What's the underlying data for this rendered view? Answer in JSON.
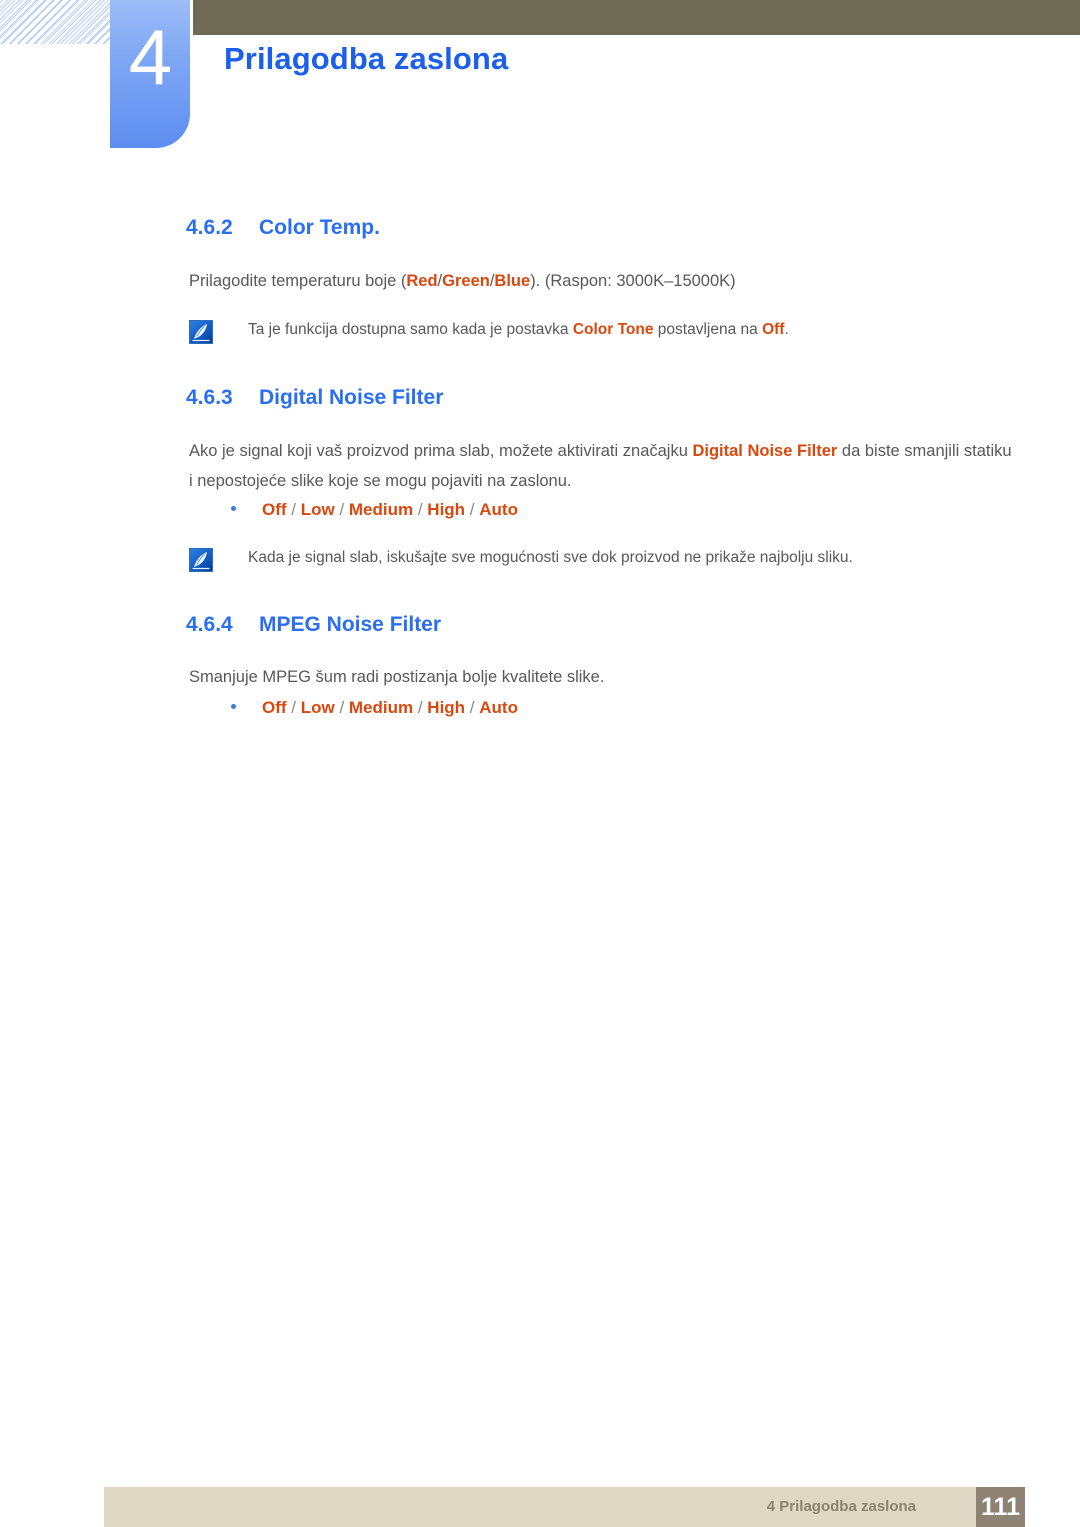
{
  "header": {
    "chapter_number": "4",
    "chapter_title": "Prilagodba zaslona",
    "accent_blue": "#1c5fe8",
    "tab_blue": "#7ea7f4",
    "olive": "#6e6a53"
  },
  "sections": [
    {
      "num": "4.6.2",
      "title": "Color Temp.",
      "body_pre": "Prilagodite temperaturu boje (",
      "body_hl1": "Red",
      "body_sep1": "/",
      "body_hl2": "Green",
      "body_sep2": "/",
      "body_hl3": "Blue",
      "body_post": "). (Raspon: 3000K–15000K)"
    },
    {
      "num": "4.6.3",
      "title": "Digital Noise Filter",
      "body_line1_pre": "Ako je signal koji vaš proizvod prima slab, možete aktivirati značajku ",
      "body_line1_hl": "Digital Noise Filter",
      "body_line1_post": " da biste smanjili",
      "body_line2": "statiku i nepostojeće slike koje se mogu pojaviti na zaslonu."
    },
    {
      "num": "4.6.4",
      "title": "MPEG Noise Filter",
      "body_line1": "Smanjuje MPEG šum radi postizanja bolje kvalitete slike."
    }
  ],
  "notes": [
    {
      "icon": "note-pen-icon",
      "pre": "Ta je funkcija dostupna samo kada je postavka ",
      "hl1": "Color Tone",
      "mid": " postavljena na ",
      "hl2": "Off",
      "post": "."
    },
    {
      "icon": "note-pen-icon",
      "text": "Kada je signal slab, iskušajte sve mogućnosti sve dok proizvod ne prikaže najbolju sliku."
    }
  ],
  "option_lists": [
    {
      "items": [
        "Off",
        "Low",
        "Medium",
        "High",
        "Auto"
      ],
      "separator": " / ",
      "color": "#d9480f"
    },
    {
      "items": [
        "Off",
        "Low",
        "Medium",
        "High",
        "Auto"
      ],
      "separator": " / ",
      "color": "#d9480f"
    }
  ],
  "footer": {
    "text": "4 Prilagodba zaslona",
    "page_number": "111",
    "bar_color": "#ded8c4",
    "box_color": "#8e8272"
  }
}
